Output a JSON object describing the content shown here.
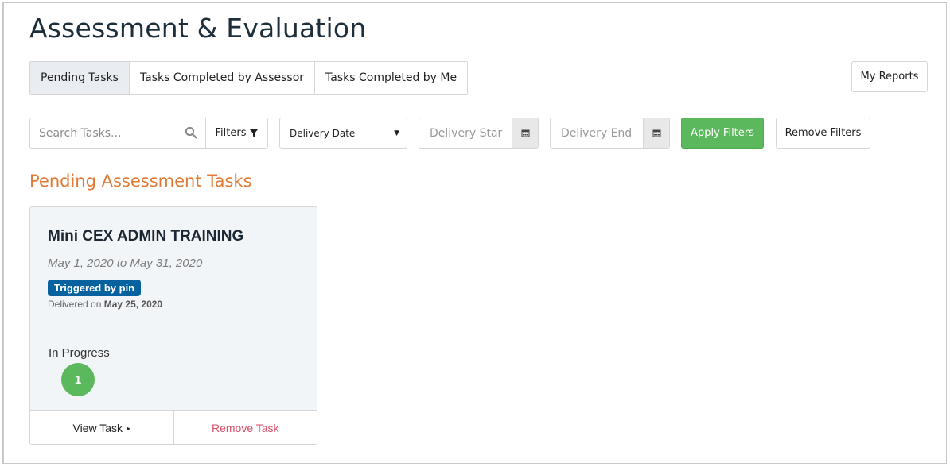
{
  "page": {
    "title": "Assessment & Evaluation"
  },
  "tabs": [
    {
      "label": "Pending Tasks",
      "active": true
    },
    {
      "label": "Tasks Completed by Assessor",
      "active": false
    },
    {
      "label": "Tasks Completed by Me",
      "active": false
    }
  ],
  "header": {
    "my_reports_label": "My Reports"
  },
  "filters": {
    "search_placeholder": "Search Tasks...",
    "filters_label": "Filters",
    "date_type_selected": "Delivery Date",
    "delivery_start_placeholder": "Delivery Star",
    "delivery_end_placeholder": "Delivery End",
    "apply_label": "Apply Filters",
    "remove_label": "Remove Filters"
  },
  "section": {
    "title": "Pending Assessment Tasks"
  },
  "tasks": [
    {
      "title": "Mini CEX ADMIN TRAINING",
      "date_range": "May 1, 2020 to May 31, 2020",
      "badge": "Triggered by pin",
      "delivered_prefix": "Delivered on",
      "delivered_date": "May 25, 2020",
      "status_label": "In Progress",
      "status_count": "1",
      "view_label": "View Task",
      "remove_label": "Remove Task"
    }
  ],
  "colors": {
    "accent_orange": "#e07b36",
    "success_green": "#5cb85c",
    "badge_blue": "#06629e",
    "danger_pink": "#d84f6a"
  },
  "icons": [
    "search-icon",
    "filter-funnel-icon",
    "caret-down-icon",
    "calendar-icon",
    "play-triangle-icon"
  ]
}
